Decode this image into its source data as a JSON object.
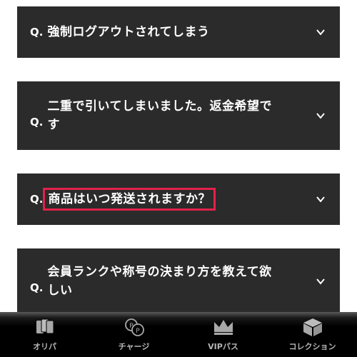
{
  "faq": {
    "prefix": "Q.",
    "items": [
      {
        "question": "強制ログアウトされてしまう"
      },
      {
        "question_line1": "二重で引いてしまいました。返金希望で",
        "question_line2": "す"
      },
      {
        "question": "商品はいつ発送されますか？"
      },
      {
        "question_line1": "会員ランクや称号の決まり方を教えて欲",
        "question_line2": "しい"
      }
    ]
  },
  "nav": {
    "tabs": [
      {
        "label": "オリパ",
        "icon": "cards-icon"
      },
      {
        "label": "チャージ",
        "icon": "coins-icon"
      },
      {
        "label": "VIPパス",
        "icon": "crown-icon"
      },
      {
        "label": "コレクション",
        "icon": "box-icon"
      }
    ]
  },
  "colors": {
    "card_bg": "#2b2b2b",
    "highlight": "#e2214b",
    "nav_bg": "#000000",
    "nav_text": "#b5b5b5"
  }
}
